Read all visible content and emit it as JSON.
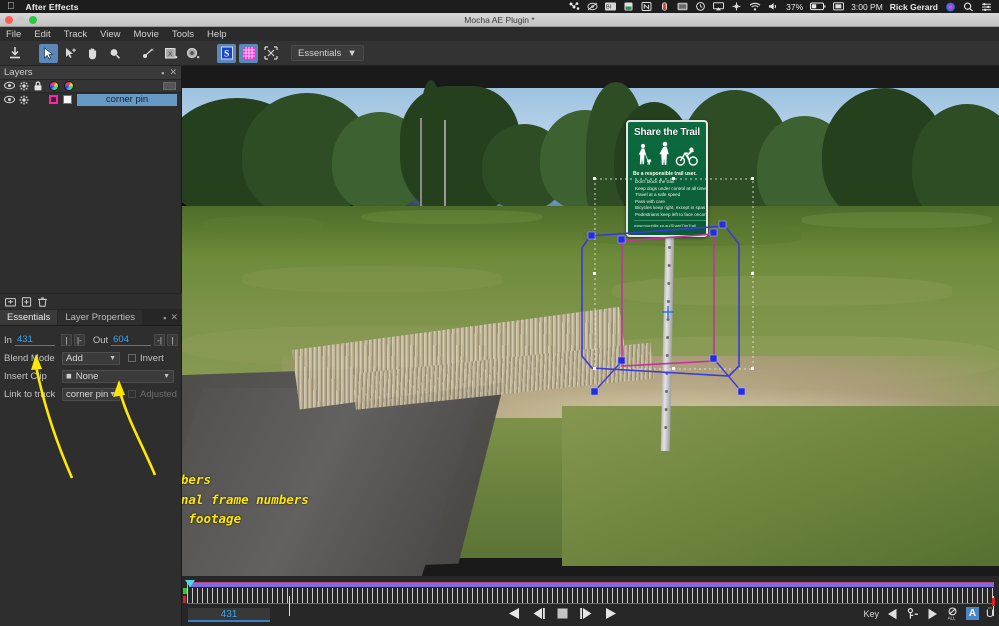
{
  "os_menubar": {
    "apple_logo": "apple-logo",
    "app_name": "After Effects",
    "battery_percent": "37%",
    "time": "3:00 PM",
    "user_name": "Rick Gerard",
    "status_icons": [
      "dropbox-icon",
      "do-not-disturb-icon",
      "bluetooth-icon",
      "battery-app-icon",
      "n-app-icon",
      "thermometer-icon",
      "display-icon",
      "time-machine-icon",
      "airplay-icon",
      "crosshair-icon",
      "wifi-icon",
      "volume-icon",
      "battery-icon",
      "input-source-icon",
      "spotlight-icon",
      "control-center-icon"
    ]
  },
  "window": {
    "title": "Mocha AE Plugin *",
    "traffic_lights": [
      "close",
      "minimize",
      "zoom"
    ]
  },
  "menubar": {
    "items": [
      "File",
      "Edit",
      "Track",
      "View",
      "Movie",
      "Tools",
      "Help"
    ]
  },
  "toolbar": {
    "tools": [
      {
        "name": "import-icon",
        "glyph": "import",
        "selected": false
      },
      {
        "name": "select-tool",
        "glyph": "arrow",
        "selected": true
      },
      {
        "name": "add-point-tool",
        "glyph": "arrow-plus",
        "selected": false
      },
      {
        "name": "pan-tool",
        "glyph": "hand",
        "selected": false
      },
      {
        "name": "zoom-tool",
        "glyph": "magnifier",
        "selected": false
      },
      {
        "name": "pin-tool",
        "glyph": "pin",
        "selected": false
      },
      {
        "name": "x-spline-tool",
        "glyph": "x-box",
        "selected": false
      },
      {
        "name": "o-spline-tool",
        "glyph": "o-box",
        "selected": false
      },
      {
        "name": "surface-tool",
        "glyph": "S",
        "selected": true
      },
      {
        "name": "grid-tool",
        "glyph": "grid",
        "selected": true
      },
      {
        "name": "transform-tool",
        "glyph": "transform",
        "selected": false
      }
    ],
    "workspace_label": "Essentials"
  },
  "layers_panel": {
    "title": "Layers",
    "header_icons": [
      "eye-icon",
      "gear-icon",
      "lock-icon",
      "color-wheel-stroke",
      "color-wheel-fill"
    ],
    "rows": [
      {
        "name": "corner pin",
        "visible": true,
        "selected": true,
        "stroke_color": "#ff22aa",
        "fill_color": "#ffffff"
      }
    ],
    "footer_buttons": [
      "new-group-button",
      "new-layer-button",
      "delete-layer-button"
    ]
  },
  "tabs": [
    {
      "label": "Essentials",
      "active": true
    },
    {
      "label": "Layer Properties",
      "active": false
    }
  ],
  "properties": {
    "in_label": "In",
    "in_value": "431",
    "out_label": "Out",
    "out_value": "604",
    "in_btn_1": "|",
    "in_btn_2": "|-",
    "out_btn_1": "-|",
    "out_btn_2": "|",
    "blend_mode_label": "Blend Mode",
    "blend_mode_value": "Add",
    "invert_label": "Invert",
    "insert_clip_label": "Insert Clip",
    "insert_clip_value": "None",
    "link_to_track_label": "Link to track",
    "link_to_track_value": "corner pin",
    "adjusted_label": "Adjusted"
  },
  "annotation": {
    "line1": "These frame numbers",
    "line2": "match the original frame numbers",
    "line3": "of the original footage",
    "color": "#ffe800"
  },
  "viewer": {
    "sign": {
      "heading": "Share the Trail",
      "subheading": "Be a responsible trail user.",
      "rules": [
        "Don't block the trail",
        "Keep dogs under control at all times",
        "Travel at a safe speed",
        "Pass with care",
        "Bicycles keep right, except in spas",
        "Pedestrians keep left to face oncoming cyclists"
      ],
      "url": "www.moretille.co.au/ShareTheTrail",
      "pictograms": [
        "dog-walker-icon",
        "pedestrian-icon",
        "cyclist-icon"
      ],
      "bg_color": "#0a5c36"
    },
    "spline_color": "#c233a0",
    "surface_color": "#3a3ac8",
    "handle_color": "#2a2ae0"
  },
  "timeline": {
    "current_frame": "431",
    "bar_color": "#7a6fe0",
    "playhead_color": "#4fd8e8",
    "transport_buttons": [
      "prev-keyframe-button",
      "step-back-button",
      "stop-button",
      "step-forward-button",
      "play-button"
    ],
    "key_label": "Key",
    "key_buttons": [
      "prev-key-button",
      "delete-key-button",
      "next-key-button",
      "all-keys-button",
      "a-button",
      "u-button"
    ]
  }
}
